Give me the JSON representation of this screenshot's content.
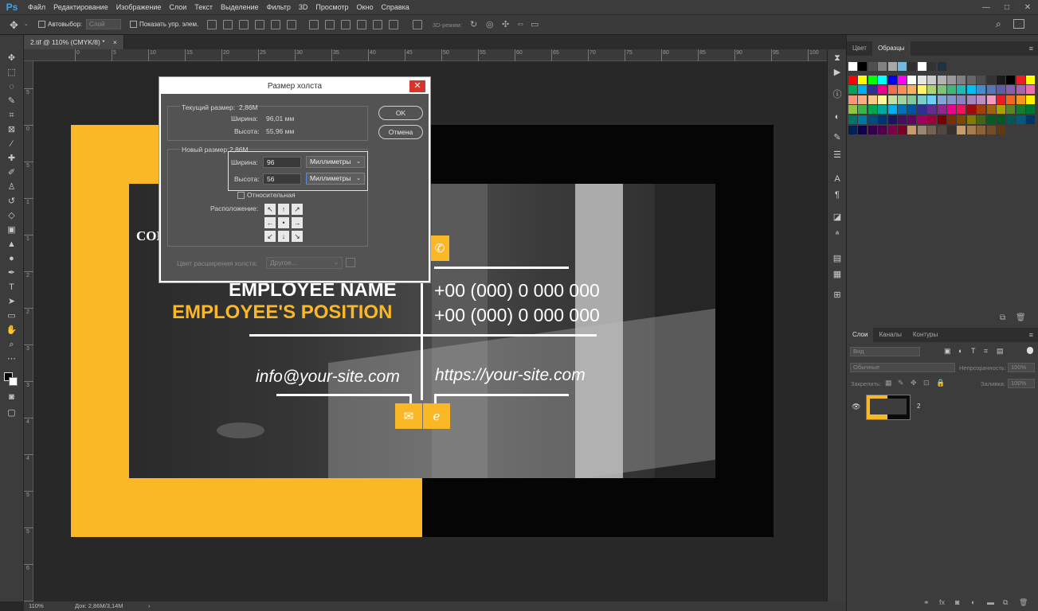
{
  "app": {
    "logo": "Ps"
  },
  "menu": [
    "Файл",
    "Редактирование",
    "Изображение",
    "Слои",
    "Текст",
    "Выделение",
    "Фильтр",
    "3D",
    "Просмотр",
    "Окно",
    "Справка"
  ],
  "window_controls": [
    "—",
    "□",
    "✕"
  ],
  "options": {
    "autoselect_label": "Автовыбор:",
    "autoselect_value": "Слой",
    "show_transform_label": "Показать упр. элем.",
    "mode3d_label": "3D-режим:"
  },
  "document": {
    "tab_title": "2.tif @ 110% (CMYK/8) *",
    "tab_close": "×"
  },
  "rulers": {
    "top": [
      "0",
      "5",
      "10",
      "15",
      "20",
      "25",
      "30",
      "35",
      "40",
      "45",
      "50",
      "55",
      "60",
      "65",
      "70",
      "75",
      "80",
      "85",
      "90",
      "95",
      "100"
    ],
    "left": [
      "5",
      "0",
      "5",
      "1",
      "1",
      "2",
      "2",
      "3",
      "3",
      "4",
      "4",
      "5",
      "5",
      "6",
      "6"
    ]
  },
  "status": {
    "zoom": "110%",
    "doc_size": "Док: 2,86M/3,14M",
    "arrow": "›"
  },
  "card": {
    "company": "COM",
    "employee_name": "EMPLOYEE NAME",
    "employee_position": "EMPLOYEE'S POSITION",
    "phone1": "+00 (000) 0 000 000",
    "phone2": "+00 (000) 0 000 000",
    "email": "info@your-site.com",
    "site": "https://your-site.com"
  },
  "dialog": {
    "title": "Размер холста",
    "close": "✕",
    "current_size_label": "Текущий размер:",
    "current_size_value": "2,86M",
    "width_label": "Ширина:",
    "width_value": "96,01 мм",
    "height_label": "Высота:",
    "height_value": "55,96 мм",
    "new_size_label": "Новый размер:",
    "new_size_value": "2,86M",
    "new_width_label": "Ширина:",
    "new_width_value": "96",
    "new_height_label": "Высота:",
    "new_height_value": "56",
    "units_width": "Миллиметры",
    "units_height": "Миллиметры",
    "relative_label": "Относительная",
    "anchor_label": "Расположение:",
    "ok": "OK",
    "cancel": "Отмена",
    "ext_color_label": "Цвет расширения холста:",
    "ext_color_value": "Другое..."
  },
  "panels": {
    "top_tabs": [
      "Цвет",
      "Образцы"
    ],
    "layers_tabs": [
      "Слои",
      "Каналы",
      "Контуры"
    ],
    "kind_placeholder": "Вид",
    "blend_mode": "Обычные",
    "opacity_label": "Непрозрачность:",
    "opacity_value": "100%",
    "lock_label": "Закрепить:",
    "fill_label": "Заливка:",
    "fill_value": "100%",
    "layer_name": "2"
  },
  "swatch_rows": [
    [
      "#ffffff",
      "#000000",
      "#505050",
      "#828282",
      "#a8a8a8",
      "#6fbbe5",
      "#2f2f2f",
      "#ffffff",
      "#333333",
      "#1d3440"
    ],
    [
      "#ff0000",
      "#ffff00",
      "#00ff00",
      "#00ffff",
      "#0000ff",
      "#ff00ff",
      "#ffffff",
      "#e6e6e6",
      "#cccccc",
      "#b3b3b3",
      "#999999",
      "#808080",
      "#666666",
      "#4d4d4d",
      "#333333",
      "#1a1a1a",
      "#000000",
      "#ee1d24",
      "#ffff00"
    ],
    [
      "#00a651",
      "#00aeef",
      "#2e3192",
      "#ec008c",
      "#f26c4f",
      "#f68e56",
      "#fbaf5d",
      "#fff568",
      "#acd373",
      "#7cc576",
      "#3cb878",
      "#1cbbb4",
      "#00bff3",
      "#448ccb",
      "#5574b9",
      "#605ca8",
      "#855fa8",
      "#a864a8",
      "#f06eaa"
    ],
    [
      "#f7977a",
      "#f9ad81",
      "#fdc68a",
      "#fff79a",
      "#c4df9b",
      "#a3d39c",
      "#82ca9d",
      "#7bcdc8",
      "#6ecff6",
      "#7ea7d8",
      "#8493ca",
      "#8882be",
      "#a187be",
      "#bc8dbf",
      "#f49ac2",
      "#ed1c24",
      "#f26522",
      "#f7941d",
      "#fff200"
    ],
    [
      "#8dc63f",
      "#39b54a",
      "#00a651",
      "#00a99d",
      "#00aeef",
      "#0072bc",
      "#0054a6",
      "#2e3192",
      "#662d91",
      "#92278f",
      "#ec008c",
      "#ed145b",
      "#9e0b0f",
      "#a0410d",
      "#a36209",
      "#aba000",
      "#598527",
      "#197b30",
      "#007236"
    ],
    [
      "#00746b",
      "#0076a3",
      "#004b80",
      "#003471",
      "#1b1464",
      "#440e62",
      "#630460",
      "#9e005d",
      "#9e0039",
      "#790000",
      "#7b2e00",
      "#7d4900",
      "#827b00",
      "#406618",
      "#005e20",
      "#005826",
      "#005952",
      "#005b7f",
      "#003663"
    ],
    [
      "#002157",
      "#0d004c",
      "#32004b",
      "#4b0049",
      "#7b0046",
      "#7a0026",
      "#c69c6d",
      "#998675",
      "#736357",
      "#534741",
      "#37302d",
      "#c69c6d",
      "#a67c52",
      "#8c6239",
      "#754c24",
      "#603913"
    ]
  ]
}
